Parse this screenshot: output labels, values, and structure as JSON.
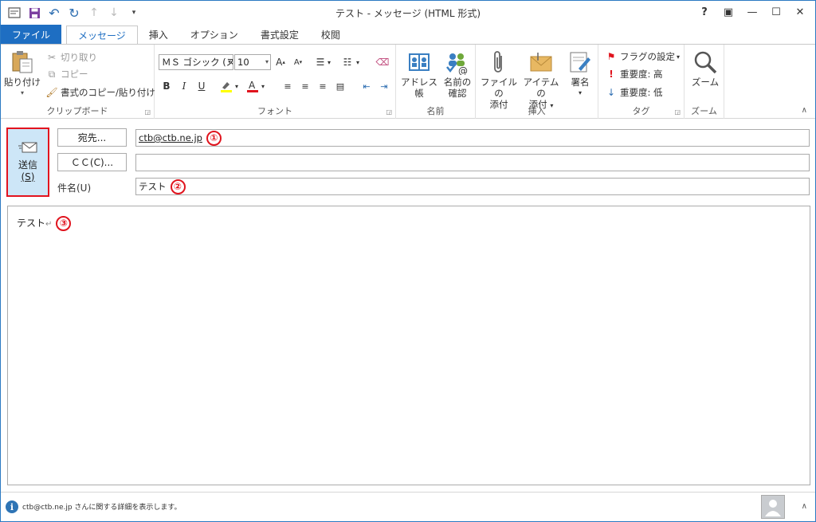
{
  "window": {
    "title": "テスト - メッセージ (HTML 形式)"
  },
  "qat": {
    "save": "save",
    "undo": "undo",
    "redo": "redo",
    "up": "up",
    "down": "down",
    "customize": "customize"
  },
  "controls": {
    "help": "?",
    "restore_ribbon": "▣",
    "minimize": "—",
    "maximize": "☐",
    "close": "✕"
  },
  "tabs": [
    {
      "label": "ファイル"
    },
    {
      "label": "メッセージ"
    },
    {
      "label": "挿入"
    },
    {
      "label": "オプション"
    },
    {
      "label": "書式設定"
    },
    {
      "label": "校閲"
    }
  ],
  "ribbon": {
    "clipboard": {
      "label": "クリップボード",
      "paste": "貼り付け",
      "cut": "切り取り",
      "copy": "コピー",
      "format_painter": "書式のコピー/貼り付け"
    },
    "font": {
      "label": "フォント",
      "font_name": "ＭＳ ゴシック (ス",
      "font_size": "10",
      "bold": "B",
      "italic": "I",
      "underline": "U"
    },
    "names": {
      "label": "名前",
      "address_book": "アドレス帳",
      "check_names_1": "名前の",
      "check_names_2": "確認"
    },
    "insert": {
      "label": "挿入",
      "attach_file_1": "ファイルの",
      "attach_file_2": "添付",
      "attach_item_1": "アイテムの",
      "attach_item_2": "添付",
      "signature": "署名"
    },
    "tags": {
      "label": "タグ",
      "flag": "フラグの設定",
      "high": "重要度: 高",
      "low": "重要度: 低"
    },
    "zoom": {
      "label": "ズーム",
      "zoom": "ズーム"
    }
  },
  "header": {
    "send_1": "送信",
    "send_2": "(S)",
    "to_button": "宛先...",
    "cc_button": "ＣＣ(C)...",
    "subject_label": "件名(U)",
    "to_value": "ctb@ctb.ne.jp",
    "cc_value": "",
    "subject_value": "テスト",
    "marker_1": "①",
    "marker_2": "②",
    "marker_3": "③"
  },
  "body": {
    "text": "テスト",
    "return_mark": "↵"
  },
  "status": {
    "text": "ctb@ctb.ne.jp さんに関する詳細を表示します。"
  },
  "colors": {
    "accent": "#1e6ec2",
    "marker": "#e0141e",
    "send_bg": "#cde6f7"
  }
}
